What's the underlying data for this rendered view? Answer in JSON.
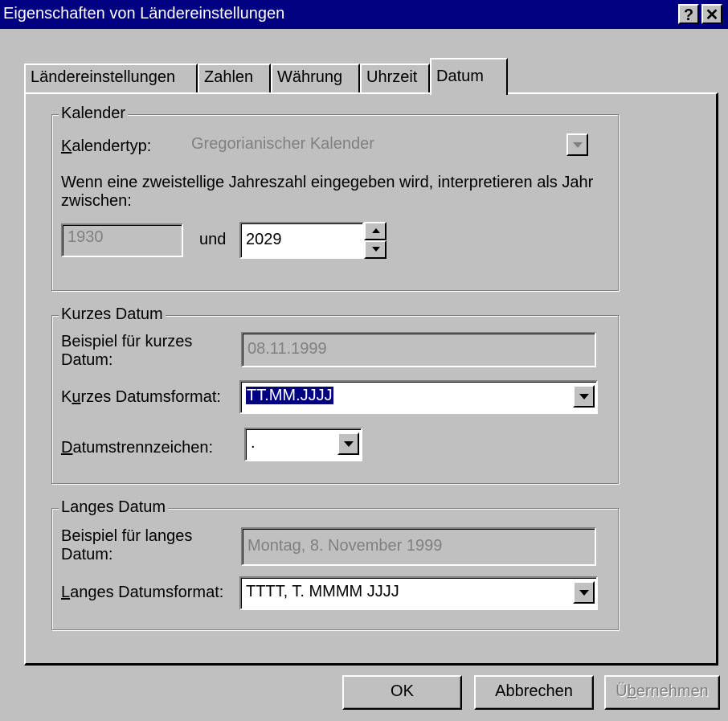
{
  "window": {
    "title": "Eigenschaften von Ländereinstellungen",
    "help_label": "?",
    "close_label": "✕"
  },
  "tabs": [
    {
      "label": "Ländereinstellungen"
    },
    {
      "label": "Zahlen"
    },
    {
      "label": "Währung"
    },
    {
      "label": "Uhrzeit"
    },
    {
      "label": "Datum",
      "active": true
    }
  ],
  "calendar": {
    "group_title": "Kalender",
    "type_label_first": "K",
    "type_label_rest": "alendertyp:",
    "type_value": "Gregorianischer Kalender",
    "description": "Wenn eine zweistellige Jahreszahl eingegeben wird, interpretieren als Jahr zwischen:",
    "year_from": "1930",
    "and_label": "und",
    "year_to": "2029"
  },
  "short_date": {
    "group_title": "Kurzes Datum",
    "sample_label": "Beispiel für kurzes Datum:",
    "sample_value": "08.11.1999",
    "format_label_pre": "K",
    "format_label_mnemonic": "u",
    "format_label_rest": "rzes Datumsformat:",
    "format_value": "TT.MM.JJJJ",
    "separator_label_first": "D",
    "separator_label_rest": "atumstrennzeichen:",
    "separator_value": "."
  },
  "long_date": {
    "group_title": "Langes Datum",
    "sample_label": "Beispiel für langes Datum:",
    "sample_value": "Montag, 8. November 1999",
    "format_label_first": "L",
    "format_label_rest": "anges Datumsformat:",
    "format_value": "TTTT, T. MMMM JJJJ"
  },
  "buttons": {
    "ok": "OK",
    "cancel": "Abbrechen",
    "apply_pre": "Ü",
    "apply_mnemonic": "b",
    "apply_rest": "ernehmen"
  }
}
